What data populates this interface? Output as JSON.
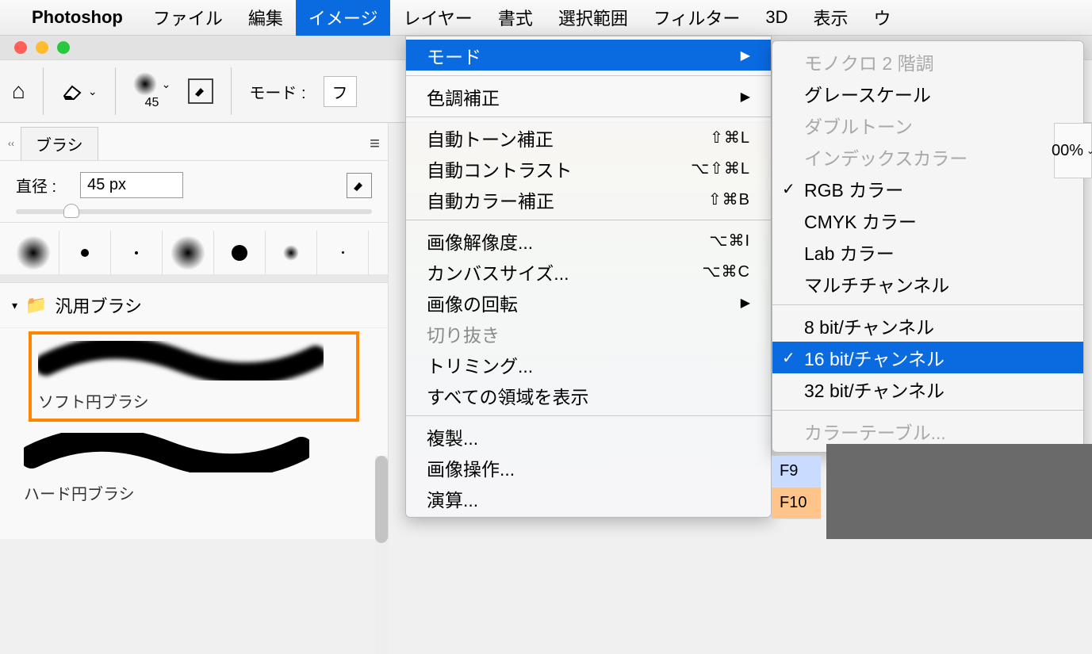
{
  "menubar": {
    "app": "Photoshop",
    "items": [
      "ファイル",
      "編集",
      "イメージ",
      "レイヤー",
      "書式",
      "選択範囲",
      "フィルター",
      "3D",
      "表示",
      "ウ"
    ],
    "active_index": 2
  },
  "toolbar": {
    "brush_size": "45",
    "mode_label": "モード :",
    "mode_value": "フ"
  },
  "brush_panel": {
    "tab": "ブラシ",
    "diameter_label": "直径 :",
    "diameter_value": "45 px",
    "folder": "汎用ブラシ",
    "brushes": [
      {
        "name": "ソフト円ブラシ",
        "selected": true,
        "soft": true
      },
      {
        "name": "ハード円ブラシ",
        "selected": false,
        "soft": false
      }
    ]
  },
  "image_menu": {
    "items": [
      {
        "label": "モード",
        "arrow": true,
        "highlight": true
      },
      "sep",
      {
        "label": "色調補正",
        "arrow": true
      },
      "sep",
      {
        "label": "自動トーン補正",
        "shortcut": "⇧⌘L"
      },
      {
        "label": "自動コントラスト",
        "shortcut": "⌥⇧⌘L"
      },
      {
        "label": "自動カラー補正",
        "shortcut": "⇧⌘B"
      },
      "sep",
      {
        "label": "画像解像度...",
        "shortcut": "⌥⌘I"
      },
      {
        "label": "カンバスサイズ...",
        "shortcut": "⌥⌘C"
      },
      {
        "label": "画像の回転",
        "arrow": true
      },
      {
        "label": "切り抜き",
        "disabled": true
      },
      {
        "label": "トリミング..."
      },
      {
        "label": "すべての領域を表示"
      },
      "sep",
      {
        "label": "複製..."
      },
      {
        "label": "画像操作..."
      },
      {
        "label": "演算..."
      }
    ]
  },
  "mode_submenu": {
    "items": [
      {
        "label": "モノクロ 2 階調",
        "disabled": true
      },
      {
        "label": "グレースケール"
      },
      {
        "label": "ダブルトーン",
        "disabled": true
      },
      {
        "label": "インデックスカラー",
        "disabled": true
      },
      {
        "label": "RGB カラー",
        "checked": true
      },
      {
        "label": "CMYK カラー"
      },
      {
        "label": "Lab カラー"
      },
      {
        "label": "マルチチャンネル"
      },
      "sep",
      {
        "label": "8 bit/チャンネル"
      },
      {
        "label": "16 bit/チャンネル",
        "checked": true,
        "highlight": true
      },
      {
        "label": "32 bit/チャンネル"
      },
      "sep",
      {
        "label": "カラーテーブル...",
        "disabled": true
      }
    ]
  },
  "right": {
    "zoom": "00%",
    "fkeys": [
      "F9",
      "F10"
    ]
  }
}
